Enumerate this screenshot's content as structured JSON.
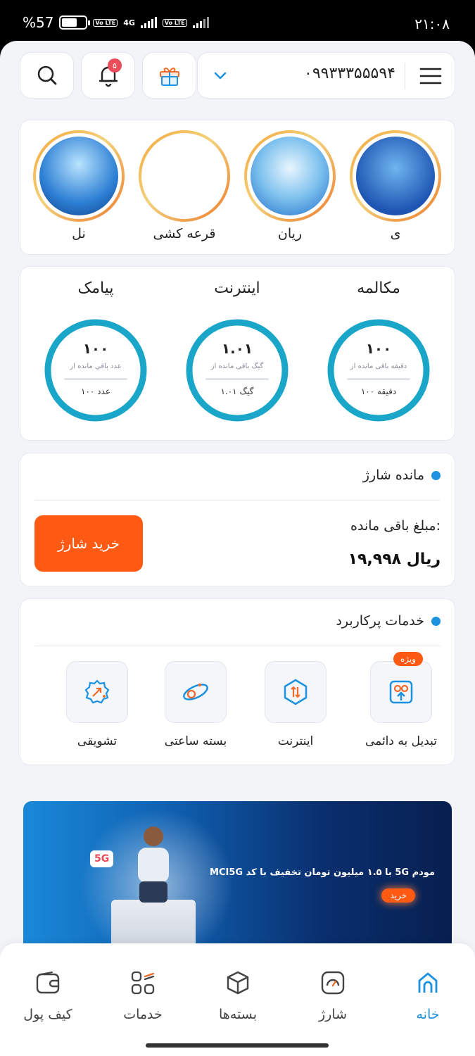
{
  "status_bar": {
    "battery": "57",
    "battery_percent_symbol": "%",
    "network": "4G",
    "volte": "Vo LTE",
    "time": "۲۱:۰۸"
  },
  "header": {
    "phone_number": "۰۹۹۳۳۳۵۵۵۹۴",
    "notification_count": "۵"
  },
  "stories": [
    {
      "label": "ی"
    },
    {
      "label": "ریان"
    },
    {
      "label": "قرعه کشی"
    },
    {
      "label": "نل"
    }
  ],
  "usage": [
    {
      "title": "مکالمه",
      "value": "۱۰۰",
      "sub": "دقیقه باقی مانده از",
      "total": "۱۰۰ دقیقه",
      "fraction": 1.0
    },
    {
      "title": "اینترنت",
      "value": "۱.۰۱",
      "sub": "گیگ باقی مانده از",
      "total": "۱.۰۱ گیگ",
      "fraction": 1.0
    },
    {
      "title": "پیامک",
      "value": "۱۰۰",
      "sub": "عدد باقی مانده از",
      "total": "۱۰۰ عدد",
      "fraction": 1.0
    }
  ],
  "charge": {
    "section_title": "مانده شارژ",
    "remaining_label": "مبلغ باقی مانده:",
    "remaining_value": "۱۹,۹۹۸  ریال",
    "buy_label": "خرید شارژ"
  },
  "services": {
    "section_title": "خدمات پرکاربرد",
    "special_badge": "ویژه",
    "items": [
      {
        "label": "تبدیل به دائمی",
        "icon": "convert-permanent-icon"
      },
      {
        "label": "اینترنت",
        "icon": "internet-icon"
      },
      {
        "label": "بسته ساعتی",
        "icon": "hourly-package-icon"
      },
      {
        "label": "تشویقی",
        "icon": "reward-icon"
      }
    ]
  },
  "banner": {
    "text": "مودم 5G با ۱.۵ میلیون تومان تخفیف با کد MCI5G",
    "button": "خرید",
    "badge": "5G"
  },
  "bottom_nav": [
    {
      "label": "خانه",
      "icon": "home-icon",
      "active": true
    },
    {
      "label": "شارژ",
      "icon": "charge-icon",
      "active": false
    },
    {
      "label": "بسته‌ها",
      "icon": "packages-icon",
      "active": false
    },
    {
      "label": "خدمات",
      "icon": "services-grid-icon",
      "active": false
    },
    {
      "label": "کیف پول",
      "icon": "wallet-icon",
      "active": false
    }
  ],
  "colors": {
    "accent": "#1c92e0",
    "gauge": "#1aa6c8",
    "orange": "#ff5a14",
    "badge_red": "#e94d5a"
  }
}
